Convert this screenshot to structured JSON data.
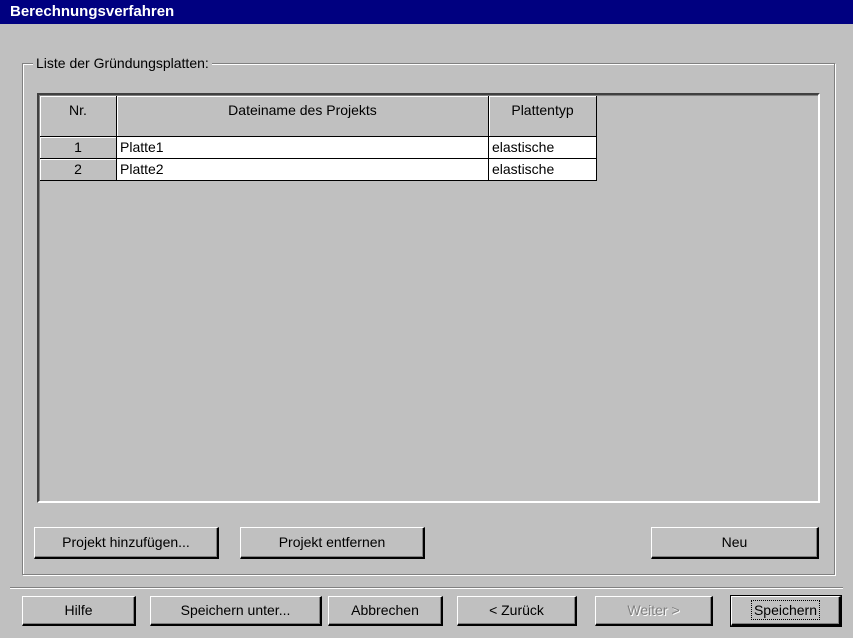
{
  "window": {
    "title": "Berechnungsverfahren"
  },
  "group": {
    "label": "Liste der Gründungsplatten:"
  },
  "table": {
    "columns": [
      "Nr.",
      "Dateiname des Projekts",
      "Plattentyp"
    ],
    "rows": [
      {
        "nr": "1",
        "name": "Platte1",
        "type": "elastische"
      },
      {
        "nr": "2",
        "name": "Platte2",
        "type": "elastische"
      }
    ]
  },
  "group_buttons": {
    "add": "Projekt hinzufügen...",
    "remove": "Projekt entfernen",
    "new": "Neu"
  },
  "footer_buttons": {
    "help": "Hilfe",
    "save_as": "Speichern unter...",
    "cancel": "Abbrechen",
    "back": "< Zurück",
    "next": "Weiter >",
    "save": "Speichern"
  }
}
